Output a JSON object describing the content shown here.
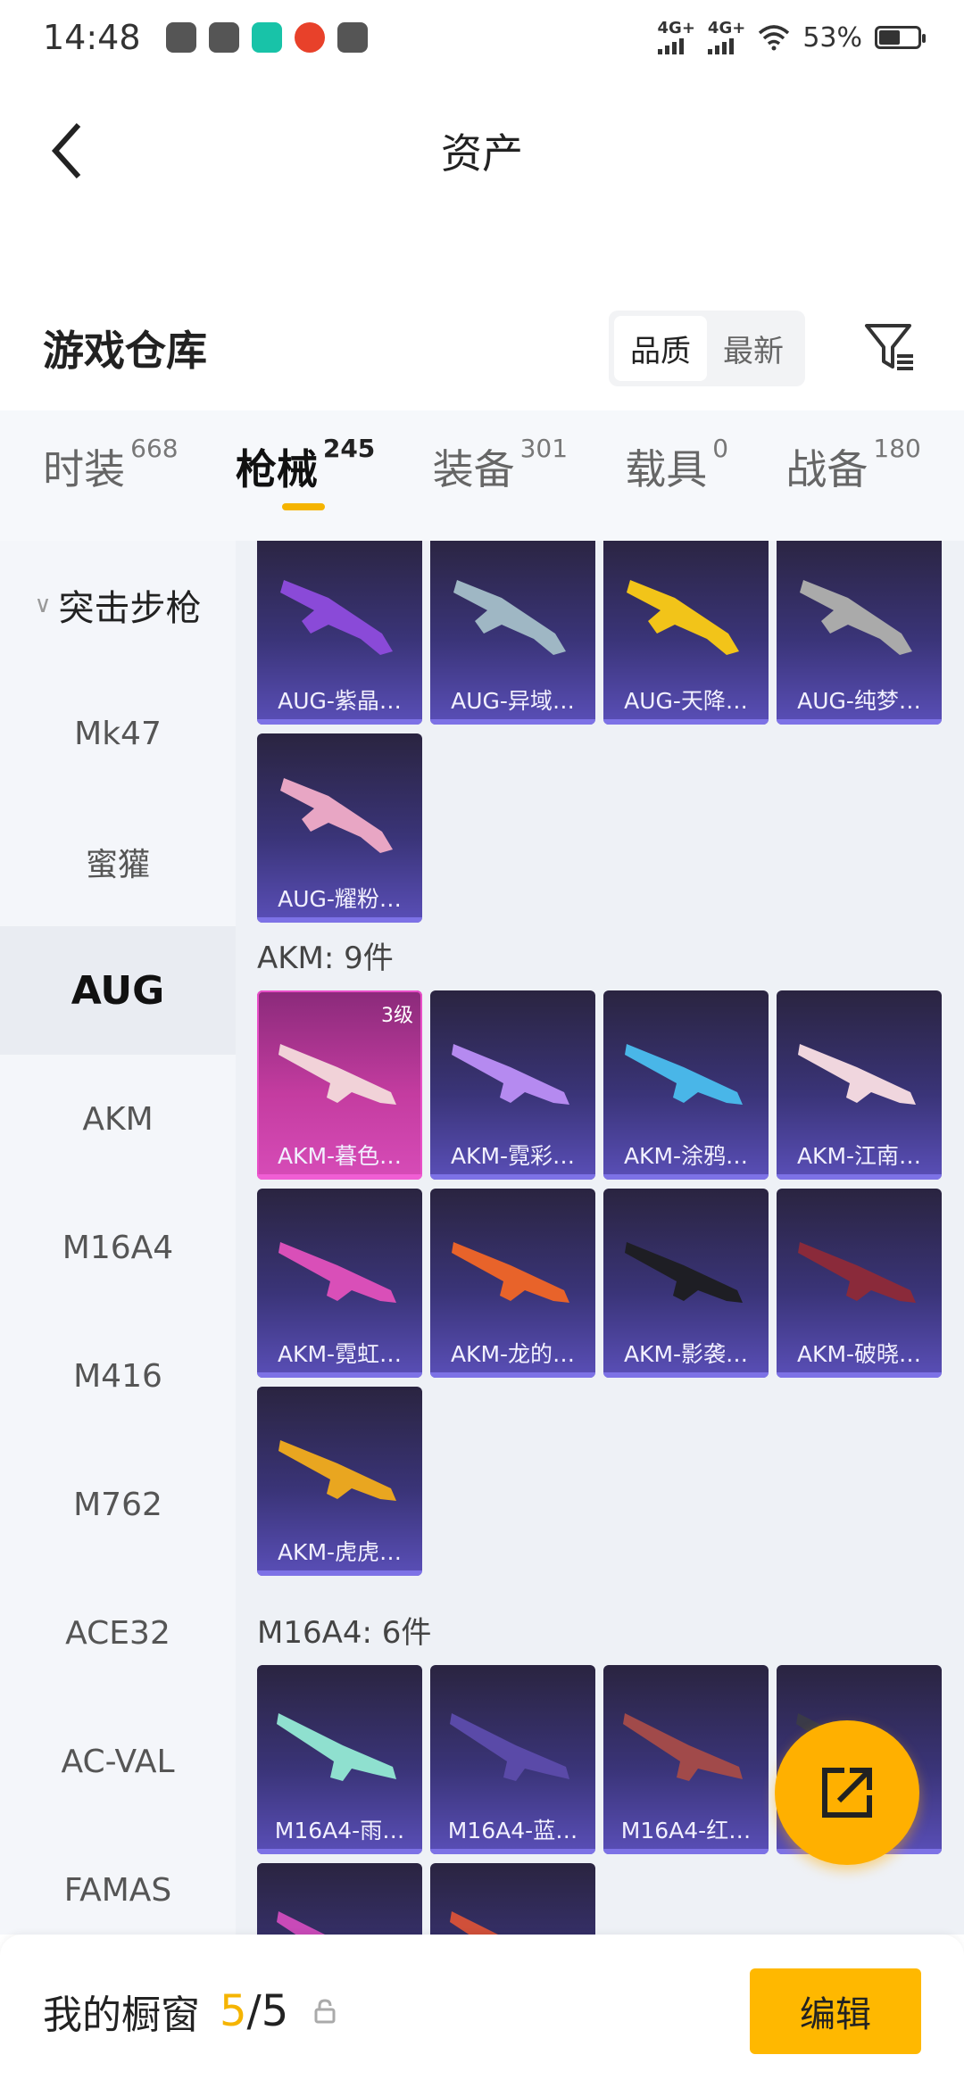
{
  "status_bar": {
    "time": "14:48",
    "network_1": "4G+",
    "network_2": "4G+",
    "battery": "53%",
    "battery_level": 0.53
  },
  "header": {
    "title": "资产"
  },
  "warehouse": {
    "title": "游戏仓库",
    "sort_options": [
      "品质",
      "最新"
    ],
    "active_sort": "品质"
  },
  "tabs": [
    {
      "label": "时装",
      "count": "668"
    },
    {
      "label": "枪械",
      "count": "245"
    },
    {
      "label": "装备",
      "count": "301"
    },
    {
      "label": "载具",
      "count": "0"
    },
    {
      "label": "战备",
      "count": "180"
    }
  ],
  "active_tab": "枪械",
  "sidebar": {
    "group": "突击步枪",
    "items": [
      "Mk47",
      "蜜獾",
      "AUG",
      "AKM",
      "M16A4",
      "M416",
      "M762",
      "ACE32",
      "AC-VAL",
      "FAMAS"
    ],
    "active": "AUG"
  },
  "sections": {
    "aug_items": [
      "AUG-紫晶…",
      "AUG-异域…",
      "AUG-天降…",
      "AUG-纯梦…",
      "AUG-耀粉…"
    ],
    "akm_title": "AKM: 9件",
    "akm_items": [
      "AKM-暮色…",
      "AKM-霓彩…",
      "AKM-涂鸦…",
      "AKM-江南…",
      "AKM-霓虹…",
      "AKM-龙的…",
      "AKM-影袭…",
      "AKM-破晓…",
      "AKM-虎虎…"
    ],
    "akm_first_level": "3级",
    "m16_title": "M16A4: 6件",
    "m16_items": [
      "M16A4-雨…",
      "M16A4-蓝…",
      "M16A4-红…"
    ]
  },
  "bottom": {
    "label": "我的橱窗",
    "current": "5",
    "separator": "/",
    "total": "5",
    "edit_label": "编辑"
  },
  "colors": {
    "accent": "#ffb800",
    "card_bottom": "#5a4fb8",
    "card_pink": "#d74cb8"
  }
}
